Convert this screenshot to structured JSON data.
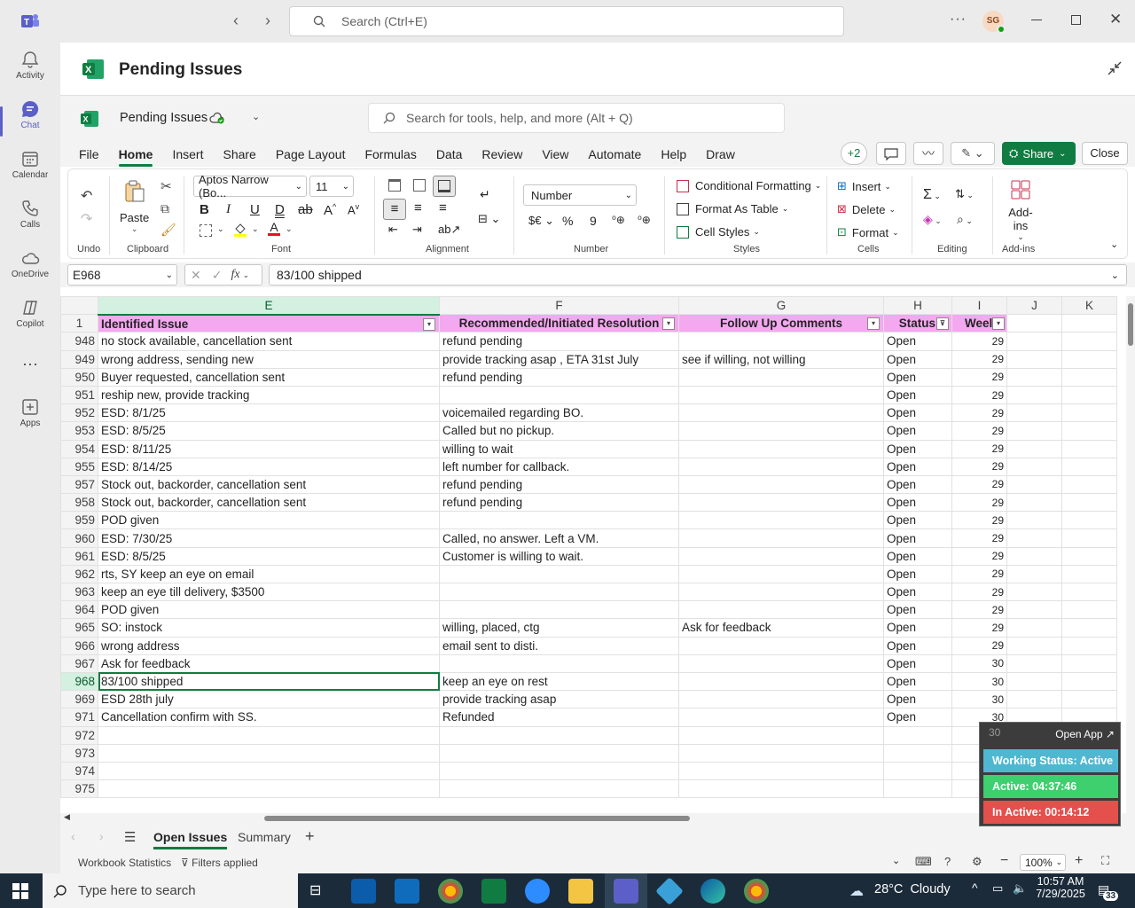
{
  "titlebar": {
    "search_placeholder": "Search (Ctrl+E)",
    "avatar": "SG"
  },
  "rail": [
    {
      "label": "Activity",
      "icon": "bell-icon"
    },
    {
      "label": "Chat",
      "icon": "chat-icon"
    },
    {
      "label": "Calendar",
      "icon": "calendar-icon"
    },
    {
      "label": "Calls",
      "icon": "phone-icon"
    },
    {
      "label": "OneDrive",
      "icon": "cloud-icon"
    },
    {
      "label": "Copilot",
      "icon": "copilot-icon"
    },
    {
      "label": "Apps",
      "icon": "apps-icon"
    }
  ],
  "tab_title": "Pending Issues",
  "excel": {
    "file_name": "Pending Issues",
    "search_placeholder": "Search for tools, help, and more (Alt + Q)"
  },
  "menu": [
    "File",
    "Home",
    "Insert",
    "Share",
    "Page Layout",
    "Formulas",
    "Data",
    "Review",
    "View",
    "Automate",
    "Help",
    "Draw"
  ],
  "header_actions": {
    "presence": "+2",
    "share": "Share",
    "close": "Close"
  },
  "ribbon": {
    "font_name": "Aptos Narrow (Bo...",
    "font_size": "11",
    "number_format": "Number",
    "paste": "Paste",
    "cond_format": "Conditional Formatting",
    "format_table": "Format As Table",
    "cell_styles": "Cell Styles",
    "insert": "Insert",
    "delete": "Delete",
    "format": "Format",
    "addins": "Add-ins",
    "groups": {
      "undo": "Undo",
      "clipboard": "Clipboard",
      "font": "Font",
      "alignment": "Alignment",
      "number": "Number",
      "styles": "Styles",
      "cells": "Cells",
      "editing": "Editing",
      "addins": "Add-ins"
    }
  },
  "formula_bar": {
    "name_box": "E968",
    "fx": "fx",
    "value": "83/100 shipped"
  },
  "grid": {
    "columns": [
      "E",
      "F",
      "G",
      "H",
      "I",
      "J",
      "K"
    ],
    "header_row": {
      "num": "1",
      "cells": [
        "Identified Issue",
        "Recommended/Initiated Resolution",
        "Follow Up Comments",
        "Status",
        "Weel"
      ]
    },
    "rows": [
      {
        "num": "948",
        "e": "no stock available, cancellation sent",
        "f": "refund pending",
        "g": "",
        "h": "Open",
        "i": "29"
      },
      {
        "num": "949",
        "e": "wrong address, sending new",
        "f": "provide tracking asap , ETA 31st July",
        "g": "see if willing, not willing",
        "h": "Open",
        "i": "29"
      },
      {
        "num": "950",
        "e": "Buyer requested, cancellation sent",
        "f": "refund pending",
        "g": "",
        "h": "Open",
        "i": "29"
      },
      {
        "num": "951",
        "e": "reship new, provide tracking",
        "f": "",
        "g": "",
        "h": "Open",
        "i": "29"
      },
      {
        "num": "952",
        "e": " ESD: 8/1/25",
        "f": "voicemailed regarding BO.",
        "g": "",
        "h": "Open",
        "i": "29"
      },
      {
        "num": "953",
        "e": "ESD:  8/5/25",
        "f": "Called but no pickup.",
        "g": "",
        "h": "Open",
        "i": "29"
      },
      {
        "num": "954",
        "e": "ESD: 8/11/25",
        "f": "willing to wait",
        "g": "",
        "h": "Open",
        "i": "29"
      },
      {
        "num": "955",
        "e": " ESD: 8/14/25",
        "f": "left number for callback.",
        "g": "",
        "h": "Open",
        "i": "29"
      },
      {
        "num": "957",
        "e": "Stock out, backorder, cancellation sent",
        "f": "refund pending",
        "g": "",
        "h": "Open",
        "i": "29"
      },
      {
        "num": "958",
        "e": "Stock out, backorder, cancellation sent",
        "f": "refund pending",
        "g": "",
        "h": "Open",
        "i": "29"
      },
      {
        "num": "959",
        "e": "POD given",
        "f": "",
        "g": "",
        "h": "Open",
        "i": "29"
      },
      {
        "num": "960",
        "e": "ESD: 7/30/25",
        "f": "Called, no answer. Left a VM.",
        "g": "",
        "h": "Open",
        "i": "29"
      },
      {
        "num": "961",
        "e": "ESD: 8/5/25",
        "f": "Customer is willing to wait.",
        "g": "",
        "h": "Open",
        "i": "29"
      },
      {
        "num": "962",
        "e": "rts, SY keep an eye on email",
        "f": "",
        "g": "",
        "h": "Open",
        "i": "29"
      },
      {
        "num": "963",
        "e": "keep an eye till delivery, $3500",
        "f": "",
        "g": "",
        "h": "Open",
        "i": "29"
      },
      {
        "num": "964",
        "e": "POD given",
        "f": "",
        "g": "",
        "h": "Open",
        "i": "29"
      },
      {
        "num": "965",
        "e": "SO: instock",
        "f": "willing, placed, ctg",
        "g": "Ask for feedback",
        "h": "Open",
        "i": "29"
      },
      {
        "num": "966",
        "e": "wrong address",
        "f": "email sent to disti.",
        "g": "",
        "h": "Open",
        "i": "29"
      },
      {
        "num": "967",
        "e": "Ask for feedback",
        "f": "",
        "g": "",
        "h": "Open",
        "i": "30"
      },
      {
        "num": "968",
        "e": "83/100 shipped",
        "f": "keep an eye on rest",
        "g": "",
        "h": "Open",
        "i": "30"
      },
      {
        "num": "969",
        "e": "ESD 28th july",
        "f": "provide tracking asap",
        "g": "",
        "h": "Open",
        "i": "30"
      },
      {
        "num": "971",
        "e": "Cancellation confirm with SS.",
        "f": "Refunded",
        "g": "",
        "h": "Open",
        "i": "30"
      },
      {
        "num": "972",
        "e": "",
        "f": "",
        "g": "",
        "h": "",
        "i": ""
      },
      {
        "num": "973",
        "e": "",
        "f": "",
        "g": "",
        "h": "",
        "i": ""
      },
      {
        "num": "974",
        "e": "",
        "f": "",
        "g": "",
        "h": "",
        "i": ""
      },
      {
        "num": "975",
        "e": "",
        "f": "",
        "g": "",
        "h": "",
        "i": ""
      }
    ]
  },
  "sheet_tabs": [
    "Open Issues",
    "Summary"
  ],
  "status": {
    "stats": "Workbook Statistics",
    "filters": "Filters applied",
    "zoom": "100%"
  },
  "overlay": {
    "open_app": "Open App ↗",
    "working": "Working Status: Active",
    "active": "Active: 04:37:46",
    "inactive": "In Active: 00:14:12",
    "colors": {
      "working": "#4fb8d0",
      "active": "#3ecf6e",
      "inactive": "#e4504c"
    }
  },
  "taskbar": {
    "search_placeholder": "Type here to search",
    "weather": "28°C  Cloudy",
    "time": "10:57 AM",
    "date": "7/29/2025",
    "notif": "33"
  }
}
